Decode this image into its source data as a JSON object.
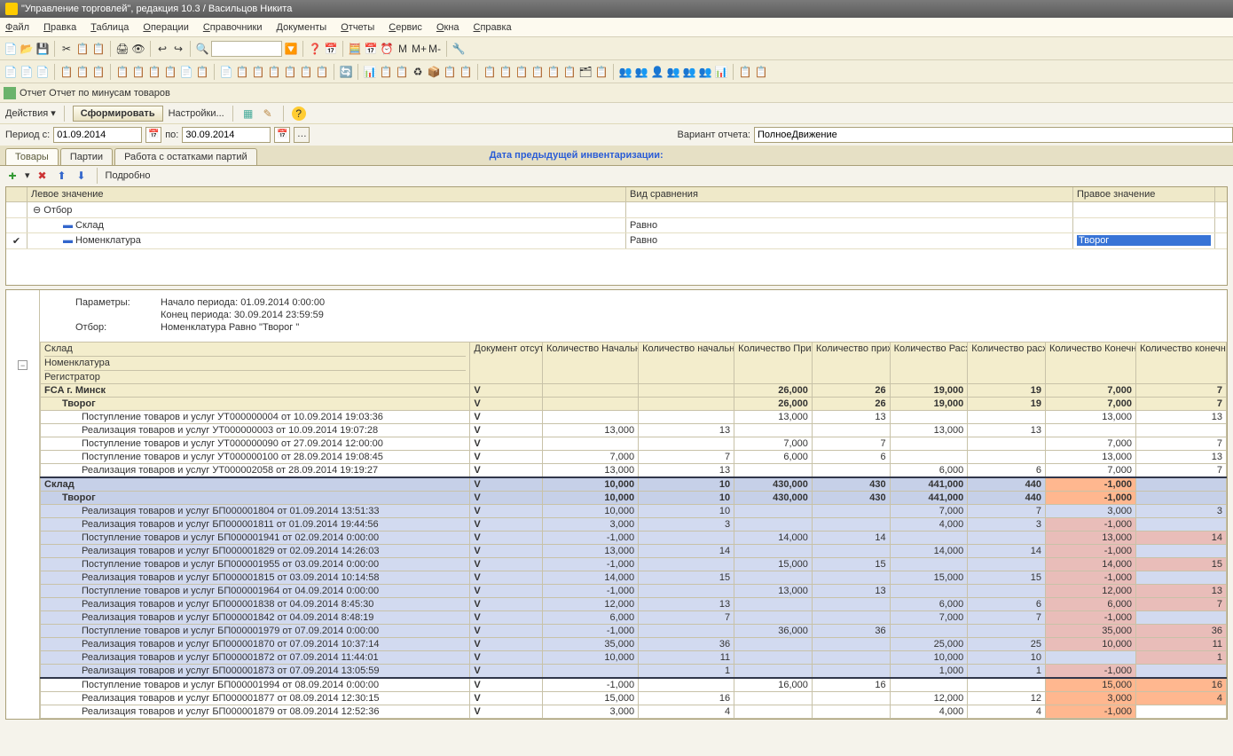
{
  "title": "\"Управление торговлей\", редакция 10.3 / Васильцов Никита",
  "menubar": [
    "Файл",
    "Правка",
    "Таблица",
    "Операции",
    "Справочники",
    "Документы",
    "Отчеты",
    "Сервис",
    "Окна",
    "Справка"
  ],
  "toolbar1_icons": [
    "📄",
    "📂",
    "💾",
    "|",
    "✂",
    "📋",
    "📋",
    "|",
    "🖨",
    "👁",
    "|",
    "↩",
    "↪",
    "|",
    "🔍",
    "",
    "🔽",
    "|",
    "❓",
    "📅",
    "|",
    "🧮",
    "📅",
    "⏰",
    "M",
    "M+",
    "M-",
    "|",
    "🔧"
  ],
  "toolbar2_icons": [
    "📄",
    "📄",
    "📄",
    "|",
    "📋",
    "📋",
    "📋",
    "|",
    "📋",
    "📋",
    "📋",
    "📋",
    "📄",
    "📋",
    "|",
    "📄",
    "📋",
    "📋",
    "📋",
    "📋",
    "📋",
    "📋",
    "|",
    "🔄",
    "|",
    "📊",
    "📋",
    "📋",
    "♻",
    "📦",
    "📋",
    "📋",
    "|",
    "📋",
    "📋",
    "📋",
    "📋",
    "📋",
    "📋",
    "🗂",
    "📋",
    "|",
    "👥",
    "👥",
    "👤",
    "👥",
    "👥",
    "👥",
    "📊",
    "|",
    "📋",
    "📋"
  ],
  "report_title": "Отчет  Отчет по минусам товаров",
  "actions_label": "Действия",
  "form_btn": "Сформировать",
  "settings_btn": "Настройки...",
  "period": {
    "from_label": "Период с:",
    "from": "01.09.2014",
    "to_label": "по:",
    "to": "30.09.2014"
  },
  "variant": {
    "label": "Вариант отчета:",
    "value": "ПолноеДвижение"
  },
  "tabs": [
    "Товары",
    "Партии",
    "Работа с остатками партий"
  ],
  "inv_label": "Дата предыдущей инвентаризации:",
  "detail_btn": "Подробно",
  "filter": {
    "headers": [
      "",
      "Левое значение",
      "Вид сравнения",
      "Правое значение"
    ],
    "rows": [
      {
        "check": "",
        "exp": "⊖",
        "label": "Отбор",
        "cmp": "",
        "val": ""
      },
      {
        "check": "",
        "exp": "",
        "label": "Склад",
        "cmp": "Равно",
        "val": "",
        "indent": true,
        "bullet": true
      },
      {
        "check": "✔",
        "exp": "",
        "label": "Номенклатура",
        "cmp": "Равно",
        "val": "Творог",
        "indent": true,
        "bullet": true,
        "selected": true
      }
    ]
  },
  "params": {
    "label": "Параметры:",
    "start": "Начало периода: 01.09.2014 0:00:00",
    "end": "Конец периода: 30.09.2014 23:59:59",
    "filter_label": "Отбор:",
    "filter_text": "Номенклатура Равно \"Творог \""
  },
  "columns": {
    "col_labels": [
      "Склад",
      "Документ отсутствует",
      "Количество Начальный остаток",
      "Количество начальный остаток П",
      "Количество Приход",
      "Количество приход П",
      "Количество Расход",
      "Количество расход П",
      "Количество Конечный остаток",
      "Количество конечный остаток П"
    ],
    "sub1": "Номенклатура",
    "sub2": "Регистратор"
  },
  "rows": [
    {
      "cls": "lvl0",
      "c": [
        "FCA г. Минск",
        "V",
        "",
        "",
        "26,000",
        "26",
        "19,000",
        "19",
        "7,000",
        "7"
      ]
    },
    {
      "cls": "lvl1 indented",
      "c": [
        "Творог",
        "V",
        "",
        "",
        "26,000",
        "26",
        "19,000",
        "19",
        "7,000",
        "7"
      ]
    },
    {
      "cls": "indent2",
      "c": [
        "Поступление товаров и услуг УТ000000004 от 10.09.2014 19:03:36",
        "V",
        "",
        "",
        "13,000",
        "13",
        "",
        "",
        "13,000",
        "13"
      ]
    },
    {
      "cls": "indent2",
      "c": [
        "Реализация товаров и услуг УТ000000003 от 10.09.2014 19:07:28",
        "V",
        "13,000",
        "13",
        "",
        "",
        "13,000",
        "13",
        "",
        ""
      ]
    },
    {
      "cls": "indent2",
      "c": [
        "Поступление товаров и услуг УТ000000090 от 27.09.2014 12:00:00",
        "V",
        "",
        "",
        "7,000",
        "7",
        "",
        "",
        "7,000",
        "7"
      ]
    },
    {
      "cls": "indent2",
      "c": [
        "Поступление товаров и услуг УТ000000100 от 28.09.2014 19:08:45",
        "V",
        "7,000",
        "7",
        "6,000",
        "6",
        "",
        "",
        "13,000",
        "13"
      ]
    },
    {
      "cls": "indent2",
      "c": [
        "Реализация товаров и услуг УТ000002058 от 28.09.2014 19:19:27",
        "V",
        "13,000",
        "13",
        "",
        "",
        "6,000",
        "6",
        "7,000",
        "7"
      ]
    },
    {
      "cls": "group0",
      "c": [
        "Склад",
        "V",
        "10,000",
        "10",
        "430,000",
        "430",
        "441,000",
        "440",
        "-1,000",
        ""
      ],
      "neg": [
        8
      ]
    },
    {
      "cls": "group1 indented",
      "c": [
        "Творог",
        "V",
        "10,000",
        "10",
        "430,000",
        "430",
        "441,000",
        "440",
        "-1,000",
        ""
      ],
      "neg": [
        8
      ]
    },
    {
      "cls": "blu indent2",
      "c": [
        "Реализация товаров и услуг БП000001804 от 01.09.2014 13:51:33",
        "V",
        "10,000",
        "10",
        "",
        "",
        "7,000",
        "7",
        "3,000",
        "3"
      ]
    },
    {
      "cls": "blu indent2",
      "c": [
        "Реализация товаров и услуг БП000001811 от 01.09.2014 19:44:56",
        "V",
        "3,000",
        "3",
        "",
        "",
        "4,000",
        "3",
        "-1,000",
        ""
      ],
      "neg": [
        8
      ]
    },
    {
      "cls": "blu indent2",
      "c": [
        "Поступление товаров и услуг БП000001941 от 02.09.2014 0:00:00",
        "V",
        "-1,000",
        "",
        "14,000",
        "14",
        "",
        "",
        "13,000",
        "14"
      ],
      "neg": [
        8,
        9
      ]
    },
    {
      "cls": "blu indent2",
      "c": [
        "Реализация товаров и услуг БП000001829 от 02.09.2014 14:26:03",
        "V",
        "13,000",
        "14",
        "",
        "",
        "14,000",
        "14",
        "-1,000",
        ""
      ],
      "neg": [
        8
      ]
    },
    {
      "cls": "blu indent2",
      "c": [
        "Поступление товаров и услуг БП000001955 от 03.09.2014 0:00:00",
        "V",
        "-1,000",
        "",
        "15,000",
        "15",
        "",
        "",
        "14,000",
        "15"
      ],
      "neg": [
        8,
        9
      ]
    },
    {
      "cls": "blu indent2",
      "c": [
        "Реализация товаров и услуг БП000001815 от 03.09.2014 10:14:58",
        "V",
        "14,000",
        "15",
        "",
        "",
        "15,000",
        "15",
        "-1,000",
        ""
      ],
      "neg": [
        8
      ]
    },
    {
      "cls": "blu indent2",
      "c": [
        "Поступление товаров и услуг БП000001964 от 04.09.2014 0:00:00",
        "V",
        "-1,000",
        "",
        "13,000",
        "13",
        "",
        "",
        "12,000",
        "13"
      ],
      "neg": [
        8,
        9
      ]
    },
    {
      "cls": "blu indent2",
      "c": [
        "Реализация товаров и услуг БП000001838 от 04.09.2014 8:45:30",
        "V",
        "12,000",
        "13",
        "",
        "",
        "6,000",
        "6",
        "6,000",
        "7"
      ],
      "neg": [
        8,
        9
      ]
    },
    {
      "cls": "blu indent2",
      "c": [
        "Реализация товаров и услуг БП000001842 от 04.09.2014 8:48:19",
        "V",
        "6,000",
        "7",
        "",
        "",
        "7,000",
        "7",
        "-1,000",
        ""
      ],
      "neg": [
        8
      ]
    },
    {
      "cls": "blu indent2",
      "c": [
        "Поступление товаров и услуг БП000001979 от 07.09.2014 0:00:00",
        "V",
        "-1,000",
        "",
        "36,000",
        "36",
        "",
        "",
        "35,000",
        "36"
      ],
      "neg": [
        8,
        9
      ]
    },
    {
      "cls": "blu indent2",
      "c": [
        "Реализация товаров и услуг БП000001870 от 07.09.2014 10:37:14",
        "V",
        "35,000",
        "36",
        "",
        "",
        "25,000",
        "25",
        "10,000",
        "11"
      ],
      "neg": [
        8,
        9
      ]
    },
    {
      "cls": "blu indent2",
      "c": [
        "Реализация товаров и услуг БП000001872 от 07.09.2014 11:44:01",
        "V",
        "10,000",
        "11",
        "",
        "",
        "10,000",
        "10",
        "",
        "1"
      ],
      "neg": [
        9
      ]
    },
    {
      "cls": "blu blu-last indent2",
      "c": [
        "Реализация товаров и услуг БП000001873 от 07.09.2014 13:05:59",
        "V",
        "",
        "1",
        "",
        "",
        "1,000",
        "1",
        "-1,000",
        ""
      ],
      "neg": [
        8
      ]
    },
    {
      "cls": "indent2",
      "c": [
        "Поступление товаров и услуг БП000001994 от 08.09.2014 0:00:00",
        "V",
        "-1,000",
        "",
        "16,000",
        "16",
        "",
        "",
        "15,000",
        "16"
      ],
      "neg2": [
        8,
        9
      ]
    },
    {
      "cls": "indent2",
      "c": [
        "Реализация товаров и услуг БП000001877 от 08.09.2014 12:30:15",
        "V",
        "15,000",
        "16",
        "",
        "",
        "12,000",
        "12",
        "3,000",
        "4"
      ],
      "neg2": [
        8,
        9
      ]
    },
    {
      "cls": "indent2",
      "c": [
        "Реализация товаров и услуг БП000001879 от 08.09.2014 12:52:36",
        "V",
        "3,000",
        "4",
        "",
        "",
        "4,000",
        "4",
        "-1,000",
        ""
      ],
      "neg2": [
        8
      ]
    }
  ]
}
